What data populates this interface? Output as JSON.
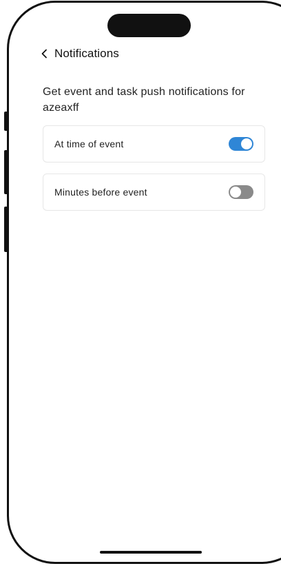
{
  "header": {
    "title": "Notifications"
  },
  "description": "Get event and task push notifications for azeaxff",
  "settings": [
    {
      "label": "At time of event",
      "enabled": true
    },
    {
      "label": "Minutes before event",
      "enabled": false
    }
  ],
  "colors": {
    "toggle_on": "#2f86d6",
    "toggle_off": "#8a8a8a"
  },
  "icons": {
    "back": "chevron-left-icon"
  }
}
